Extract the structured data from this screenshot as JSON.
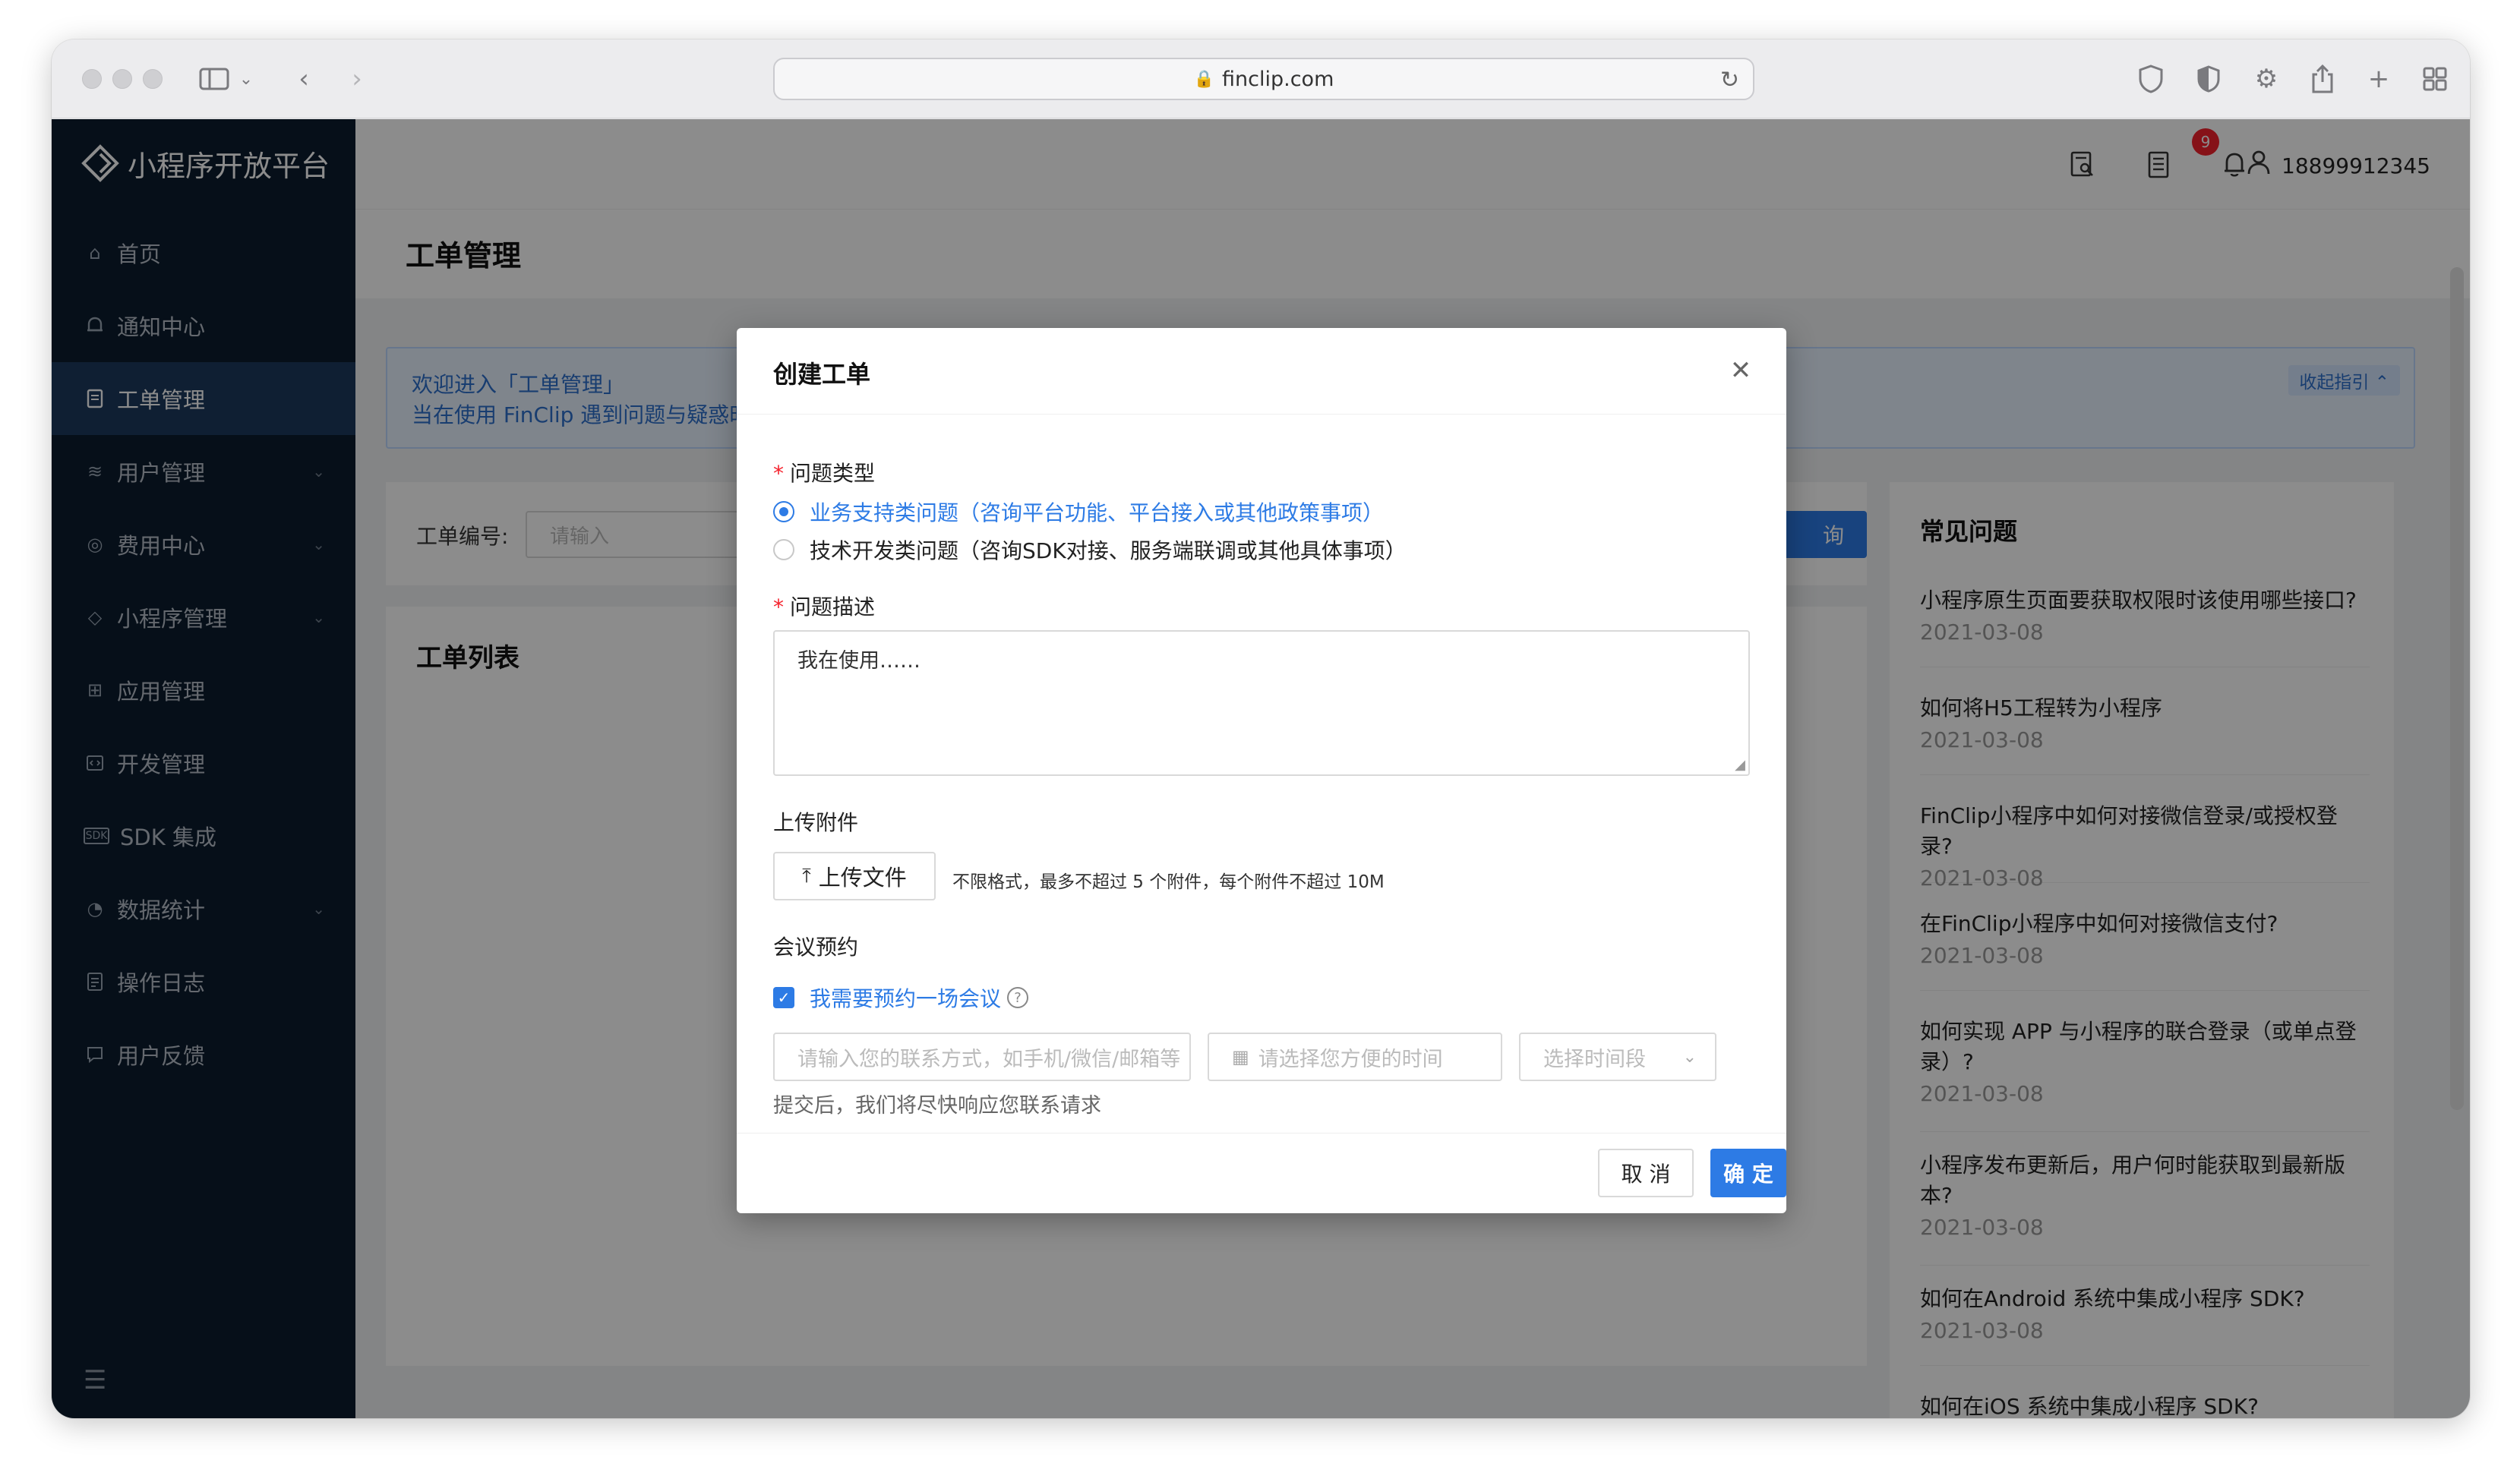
{
  "browser": {
    "url": "finclip.com"
  },
  "app": {
    "name": "小程序开放平台"
  },
  "sidebar": {
    "items": [
      {
        "label": "首页",
        "icon": "home-icon"
      },
      {
        "label": "通知中心",
        "icon": "bell-icon"
      },
      {
        "label": "工单管理",
        "icon": "ticket-icon",
        "active": true
      },
      {
        "label": "用户管理",
        "icon": "users-icon",
        "expandable": true
      },
      {
        "label": "费用中心",
        "icon": "coin-icon",
        "expandable": true
      },
      {
        "label": "小程序管理",
        "icon": "diamond-icon",
        "expandable": true
      },
      {
        "label": "应用管理",
        "icon": "grid-icon"
      },
      {
        "label": "开发管理",
        "icon": "code-icon"
      },
      {
        "label": "SDK 集成",
        "icon": "sdk-icon"
      },
      {
        "label": "数据统计",
        "icon": "chart-icon",
        "expandable": true
      },
      {
        "label": "操作日志",
        "icon": "log-icon"
      },
      {
        "label": "用户反馈",
        "icon": "feedback-icon"
      }
    ]
  },
  "topbar": {
    "notifications": "9",
    "user": "18899912345"
  },
  "page": {
    "title": "工单管理",
    "banner_line1": "欢迎进入「工单管理」",
    "banner_line2": "当在使用 FinClip 遇到问题与疑惑时",
    "banner_collapse": "收起指引 ⌃",
    "filter_label": "工单编号:",
    "filter_placeholder": "请输入",
    "query_label": "询",
    "list_title": "工单列表"
  },
  "faq": {
    "title": "常见问题",
    "items": [
      {
        "q": "小程序原生页面要获取权限时该使用哪些接口?",
        "date": "2021-03-08"
      },
      {
        "q": "如何将H5工程转为小程序",
        "date": "2021-03-08"
      },
      {
        "q": "FinClip小程序中如何对接微信登录/或授权登录?",
        "date": "2021-03-08"
      },
      {
        "q": "在FinClip小程序中如何对接微信支付?",
        "date": "2021-03-08"
      },
      {
        "q": "如何实现 APP 与小程序的联合登录（或单点登录）?",
        "date": "2021-03-08"
      },
      {
        "q": "小程序发布更新后，用户何时能获取到最新版本?",
        "date": "2021-03-08"
      },
      {
        "q": "如何在Android 系统中集成小程序 SDK?",
        "date": "2021-03-08"
      },
      {
        "q": "如何在iOS 系统中集成小程序 SDK?",
        "date": ""
      }
    ]
  },
  "modal": {
    "title": "创建工单",
    "type_label": "问题类型",
    "option1": "业务支持类问题（咨询平台功能、平台接入或其他政策事项）",
    "option2": "技术开发类问题（咨询SDK对接、服务端联调或其他具体事项）",
    "desc_label": "问题描述",
    "desc_value": "我在使用……",
    "attach_label": "上传附件",
    "upload_button": "上传文件",
    "upload_hint": "不限格式，最多不超过 5 个附件，每个附件不超过 10M",
    "meeting_label": "会议预约",
    "meeting_checkbox": "我需要预约一场会议",
    "contact_placeholder": "请输入您的联系方式，如手机/微信/邮箱等",
    "time_placeholder": "请选择您方便的时间",
    "slot_placeholder": "选择时间段",
    "submit_hint": "提交后，我们将尽快响应您联系请求",
    "cancel": "取 消",
    "ok": "确 定"
  },
  "colors": {
    "primary": "#2d7be5",
    "sidebar_bg": "#0b1c2e",
    "sidebar_active": "#1c3a5e",
    "badge": "#f5222d"
  }
}
